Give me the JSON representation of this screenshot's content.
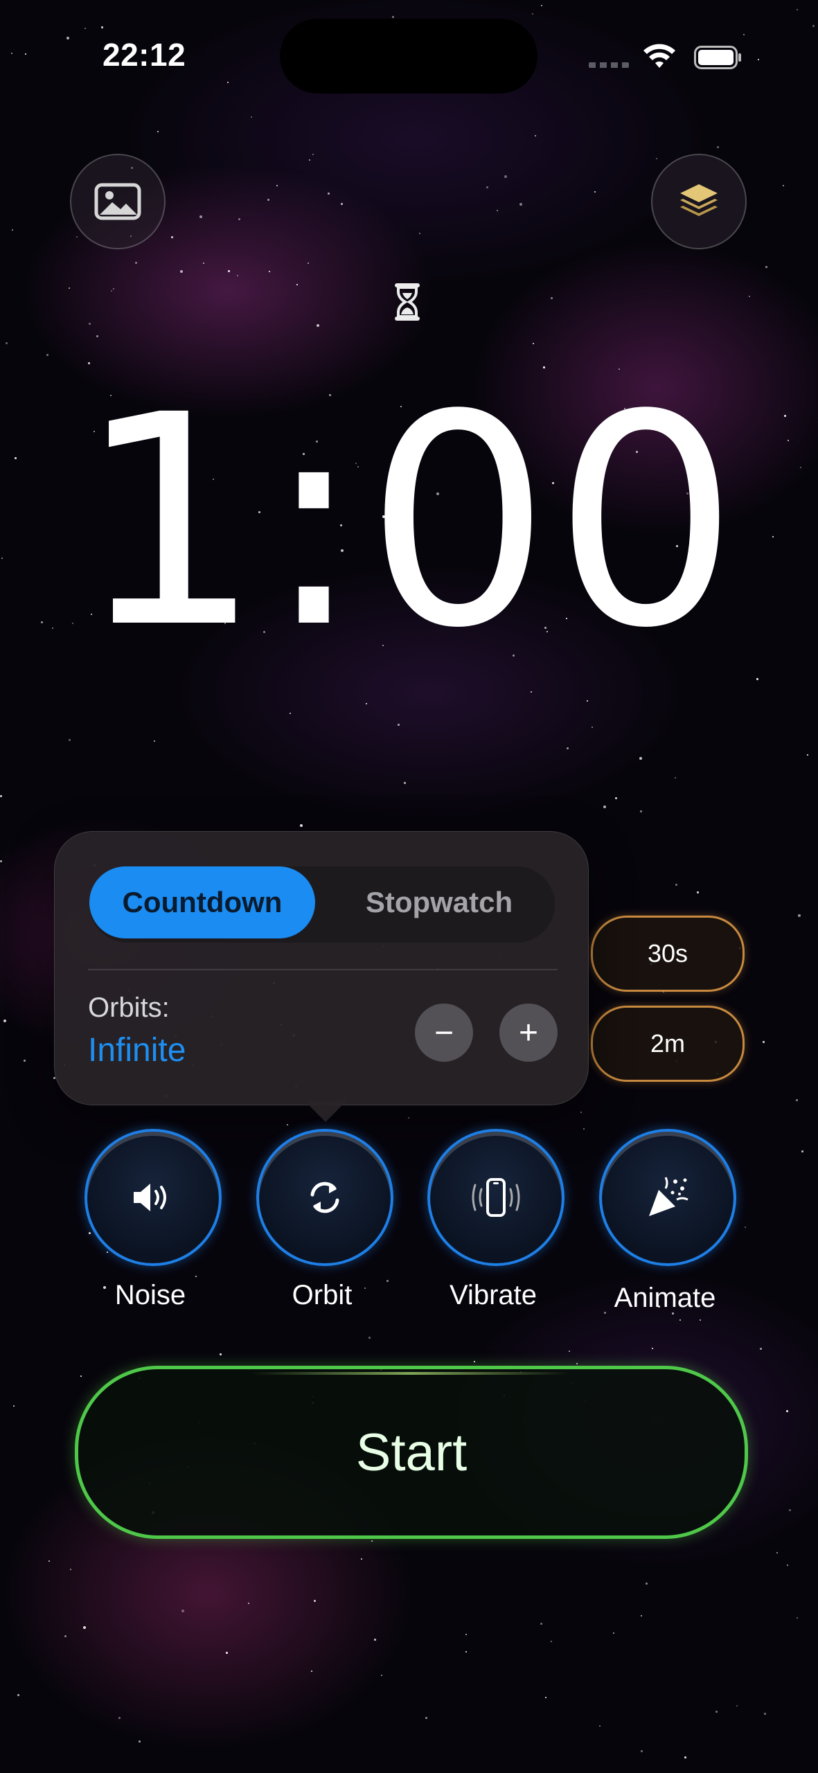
{
  "status_bar": {
    "time": "22:12",
    "icons": [
      "cellular-signal-icon",
      "wifi-icon",
      "battery-icon"
    ]
  },
  "top_buttons": {
    "left_icon": "photo-icon",
    "right_icon": "layers-icon"
  },
  "mode_icon": "hourglass-icon",
  "timer": {
    "display": "1:00"
  },
  "popover": {
    "segments": [
      {
        "label": "Countdown",
        "selected": true
      },
      {
        "label": "Stopwatch",
        "selected": false
      }
    ],
    "orbits_label": "Orbits:",
    "orbits_value": "Infinite",
    "decrement_symbol": "−",
    "increment_symbol": "+"
  },
  "presets": [
    {
      "label": "30s"
    },
    {
      "label": "2m"
    }
  ],
  "features": [
    {
      "label": "Noise",
      "icon": "speaker-icon"
    },
    {
      "label": "Orbit",
      "icon": "repeat-icon"
    },
    {
      "label": "Vibrate",
      "icon": "vibrate-phone-icon"
    },
    {
      "label": "Animate",
      "icon": "party-popper-icon"
    }
  ],
  "start_button": {
    "label": "Start"
  },
  "colors": {
    "accent_blue": "#1a8cf2",
    "preset_border": "#c88a3f",
    "start_border": "#4fc84a",
    "feature_border": "#1e7fe6"
  }
}
